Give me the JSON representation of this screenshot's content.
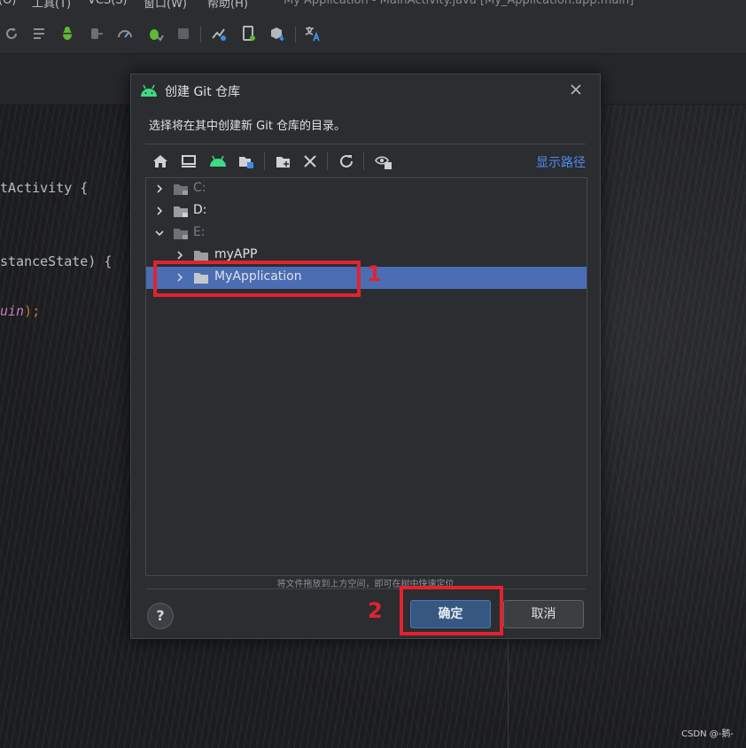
{
  "menubar": {
    "items": [
      "(O)",
      "工具(T)",
      "VCS(S)",
      "窗口(W)",
      "帮助(H)"
    ],
    "window_title": "My Application - MainActivity.java [My_Application.app.main]"
  },
  "code_lines": [
    {
      "text": "tActivity {"
    },
    {
      "text": "stanceState) {"
    },
    {
      "italic": "uin",
      "rest": ");"
    }
  ],
  "dialog": {
    "title": "创建 Git 仓库",
    "description": "选择将在其中创建新 Git 仓库的目录。",
    "show_path_label": "显示路径",
    "drop_hint": "将文件拖放到上方空间，即可在树中快速定位",
    "ok_label": "确定",
    "cancel_label": "取消",
    "help_label": "?"
  },
  "tree": {
    "rows": [
      {
        "label": "C:",
        "expanded": false,
        "dim": true
      },
      {
        "label": "D:",
        "expanded": false,
        "dim": false
      },
      {
        "label": "E:",
        "expanded": true,
        "dim": true
      },
      {
        "label": "myAPP",
        "expanded": false,
        "dim": false
      },
      {
        "label": "MyApplication",
        "expanded": false,
        "dim": false,
        "selected": true
      }
    ]
  },
  "annotations": {
    "step1": "1",
    "step2": "2"
  },
  "watermark": "CSDN @-鹅-",
  "colors": {
    "accent_link": "#548af7",
    "selection": "#4a6db4",
    "ok_button": "#365880",
    "annotation_red": "#e2232e",
    "android_green": "#3ddc84"
  }
}
